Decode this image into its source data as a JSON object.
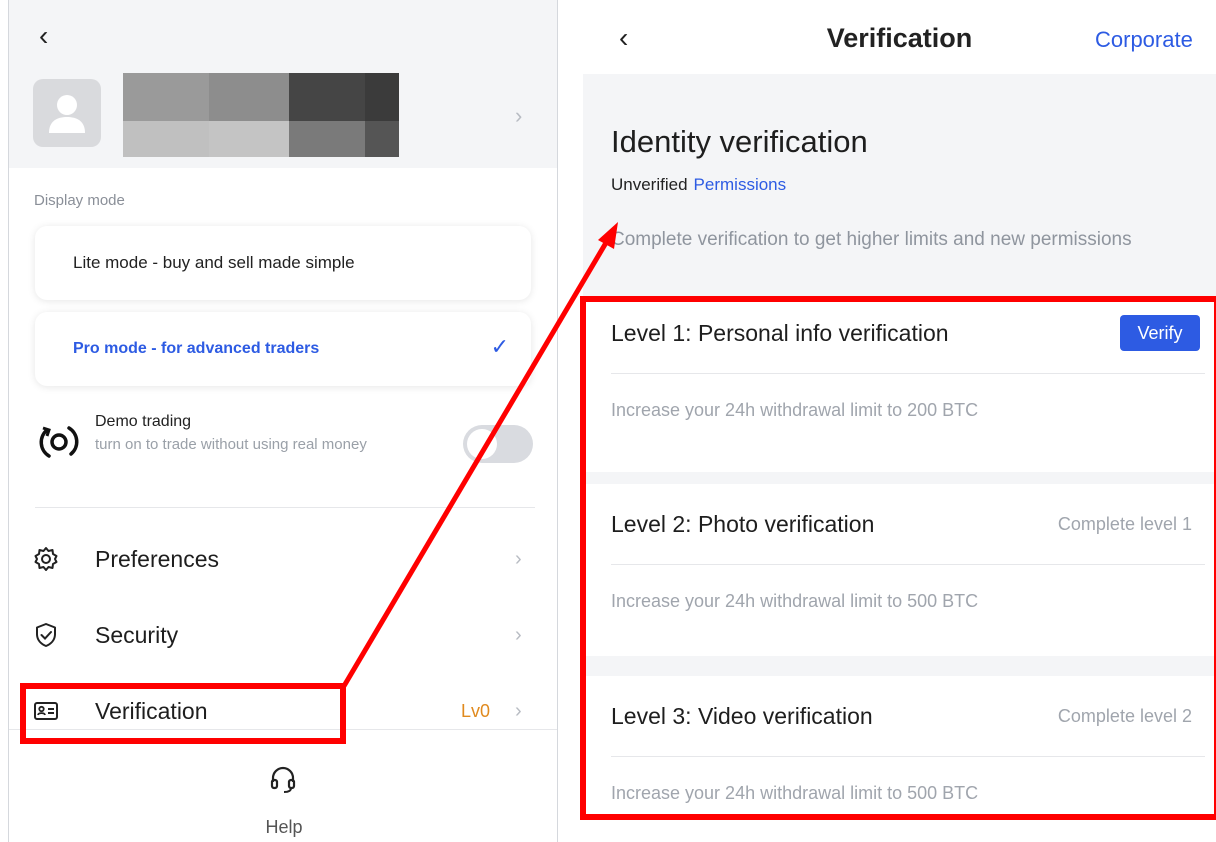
{
  "left_panel": {
    "back_icon": "chevron-left-icon",
    "display_mode_label": "Display mode",
    "lite_mode_label": "Lite mode - buy and sell made simple",
    "pro_mode_label": "Pro mode - for advanced traders",
    "demo_trading_title": "Demo trading",
    "demo_trading_subtitle": "turn on to trade without using real money",
    "demo_trading_enabled": false,
    "menu": [
      {
        "label": "Preferences",
        "icon": "gear-icon"
      },
      {
        "label": "Security",
        "icon": "shield-check-icon"
      },
      {
        "label": "Verification",
        "icon": "id-card-icon",
        "badge": "Lv0"
      }
    ],
    "help_label": "Help"
  },
  "right_panel": {
    "header_title": "Verification",
    "corporate_label": "Corporate",
    "identity_title": "Identity verification",
    "status_label": "Unverified",
    "permissions_link": "Permissions",
    "intro_text": "Complete verification to get higher limits and new permissions",
    "levels": [
      {
        "title": "Level 1: Personal info verification",
        "action": "Verify",
        "description": "Increase your 24h withdrawal limit to 200 BTC"
      },
      {
        "title": "Level 2: Photo verification",
        "status": "Complete level 1",
        "description": "Increase your 24h withdrawal limit to 500 BTC"
      },
      {
        "title": "Level 3: Video verification",
        "status": "Complete level 2",
        "description": "Increase your 24h withdrawal limit to 500 BTC"
      }
    ]
  },
  "colors": {
    "accent_blue": "#2d5be3",
    "level_badge_orange": "#e08a1e",
    "annotation_red": "#ff0000"
  }
}
